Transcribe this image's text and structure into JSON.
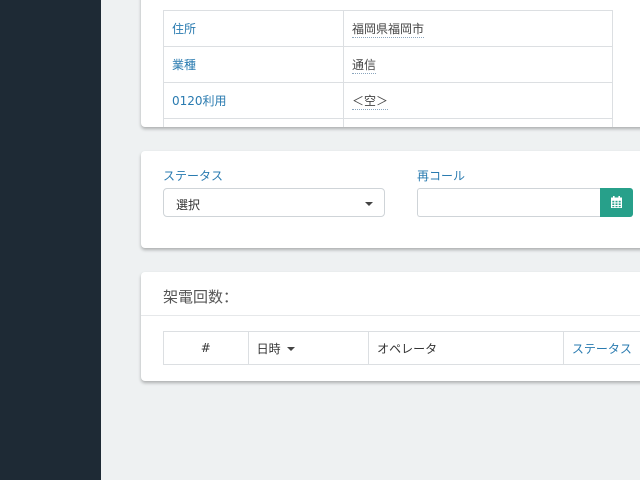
{
  "info_rows": [
    {
      "label": "住所",
      "value": "福岡県福岡市"
    },
    {
      "label": "業種",
      "value": "通信"
    },
    {
      "label": "0120利用",
      "value": "＜空＞"
    }
  ],
  "status_form": {
    "status_label": "ステータス",
    "status_selected": "選択",
    "recall_label": "再コール",
    "recall_value": ""
  },
  "calls": {
    "title": "架電回数：",
    "columns": [
      "#",
      "日時",
      "オペレータ",
      "ステータス"
    ]
  },
  "icons": {
    "calendar": "calendar-icon",
    "caret": "chevron-down-icon"
  },
  "colors": {
    "sidebar": "#1e2a35",
    "accent": "#27a08a",
    "link": "#2a7bb0",
    "background": "#eef1f2"
  }
}
